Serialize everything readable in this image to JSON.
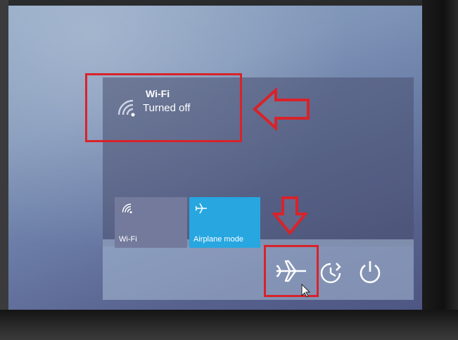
{
  "notification": {
    "title": "Wi-Fi",
    "status": "Turned off",
    "icon": "wifi-icon"
  },
  "quick_actions": [
    {
      "label": "Wi-Fi",
      "icon": "wifi-icon",
      "active": false
    },
    {
      "label": "Airplane mode",
      "icon": "airplane-icon",
      "active": true
    }
  ],
  "tray": [
    {
      "icon": "airplane-icon"
    },
    {
      "icon": "night-light-icon"
    },
    {
      "icon": "power-icon"
    }
  ],
  "colors": {
    "highlight": "#d8232a",
    "accent": "#27a6e0",
    "tile_inactive": "#737a9c"
  }
}
